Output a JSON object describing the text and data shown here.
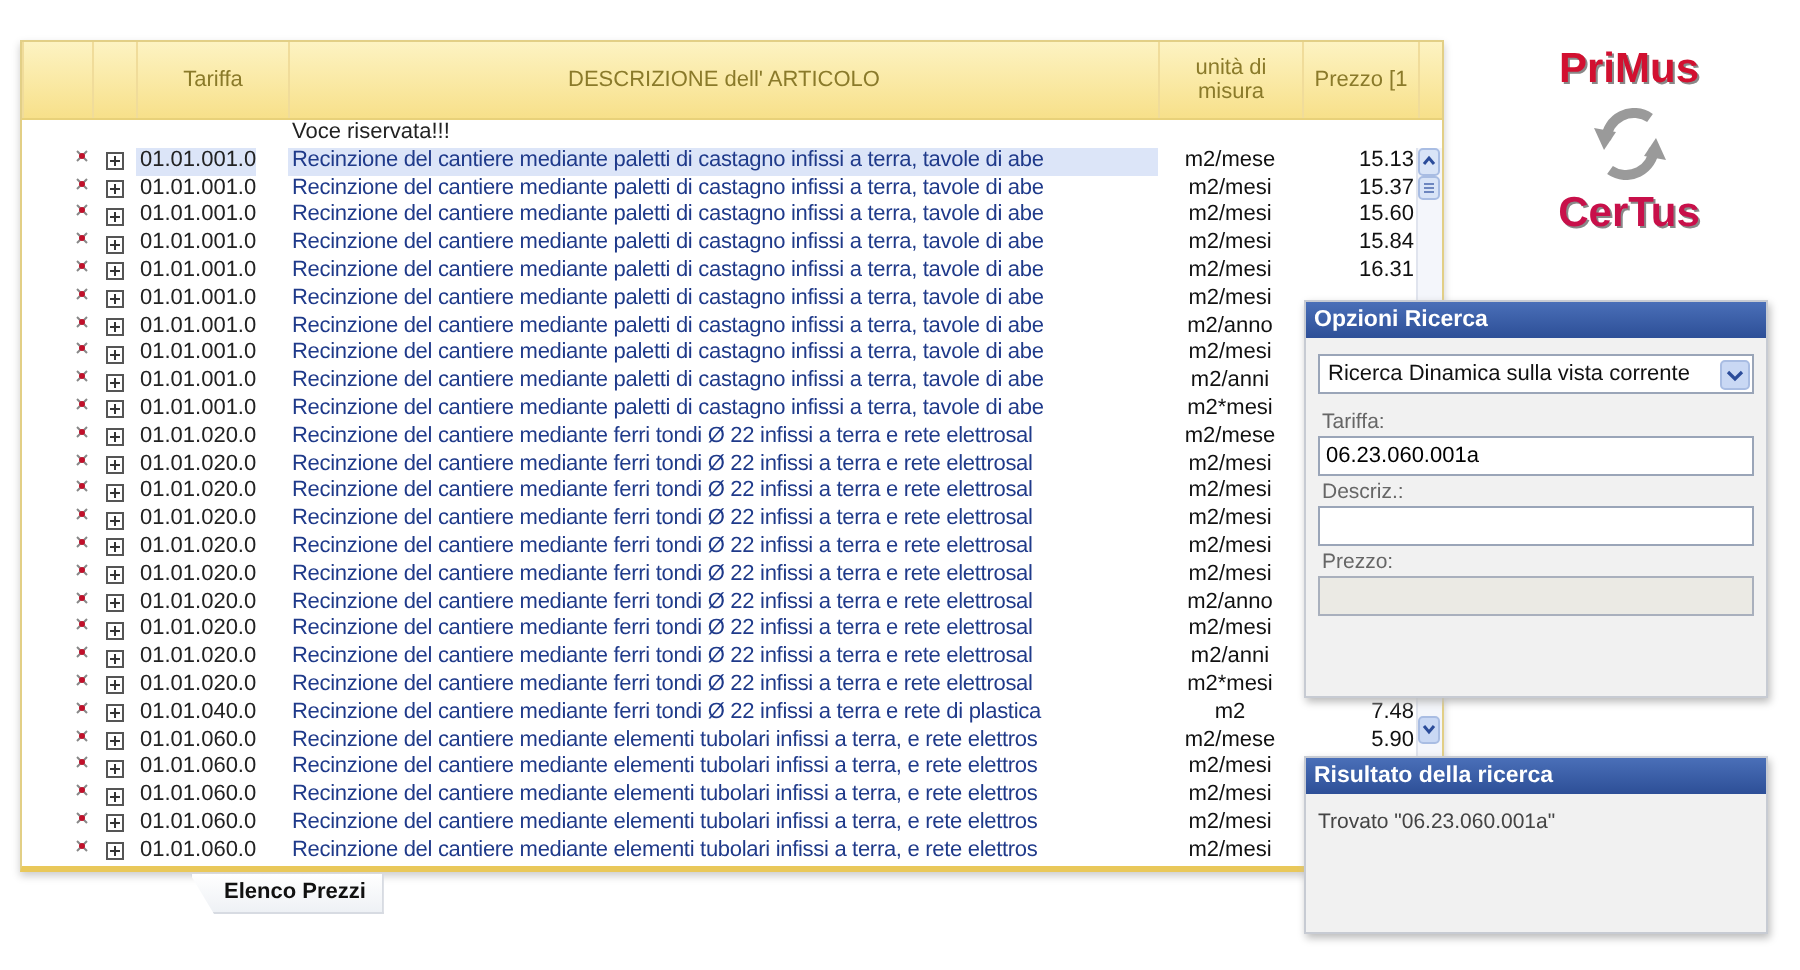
{
  "grid": {
    "columns": [
      "Tariffa",
      "DESCRIZIONE dell' ARTICOLO",
      "unità di misura",
      "Prezzo [1"
    ],
    "reserved_row": "Voce riservata!!!",
    "rows": [
      {
        "tariff": "01.01.001.0",
        "description": "Recinzione del cantiere mediante paletti di castagno infissi a terra, tavole di abe",
        "unit": "m2/mese",
        "price": "15.13",
        "selected": true
      },
      {
        "tariff": "01.01.001.0",
        "description": "Recinzione del cantiere mediante paletti di castagno infissi a terra, tavole di abe",
        "unit": "m2/mesi",
        "price": "15.37",
        "selected": false
      },
      {
        "tariff": "01.01.001.0",
        "description": "Recinzione del cantiere mediante paletti di castagno infissi a terra, tavole di abe",
        "unit": "m2/mesi",
        "price": "15.60",
        "selected": false
      },
      {
        "tariff": "01.01.001.0",
        "description": "Recinzione del cantiere mediante paletti di castagno infissi a terra, tavole di abe",
        "unit": "m2/mesi",
        "price": "15.84",
        "selected": false
      },
      {
        "tariff": "01.01.001.0",
        "description": "Recinzione del cantiere mediante paletti di castagno infissi a terra, tavole di abe",
        "unit": "m2/mesi",
        "price": "16.31",
        "selected": false
      },
      {
        "tariff": "01.01.001.0",
        "description": "Recinzione del cantiere mediante paletti di castagno infissi a terra, tavole di abe",
        "unit": "m2/mesi",
        "selected": false
      },
      {
        "tariff": "01.01.001.0",
        "description": "Recinzione del cantiere mediante paletti di castagno infissi a terra, tavole di abe",
        "unit": "m2/anno",
        "selected": false
      },
      {
        "tariff": "01.01.001.0",
        "description": "Recinzione del cantiere mediante paletti di castagno infissi a terra, tavole di abe",
        "unit": "m2/mesi",
        "selected": false
      },
      {
        "tariff": "01.01.001.0",
        "description": "Recinzione del cantiere mediante paletti di castagno infissi a terra, tavole di abe",
        "unit": "m2/anni",
        "selected": false
      },
      {
        "tariff": "01.01.001.0",
        "description": "Recinzione del cantiere mediante paletti di castagno infissi a terra, tavole di abe",
        "unit": "m2*mesi",
        "selected": false
      },
      {
        "tariff": "01.01.020.0",
        "description": "Recinzione del cantiere mediante ferri tondi Ø 22 infissi a terra e rete elettrosal",
        "unit": "m2/mese",
        "selected": false
      },
      {
        "tariff": "01.01.020.0",
        "description": "Recinzione del cantiere mediante ferri tondi Ø 22 infissi a terra e rete elettrosal",
        "unit": "m2/mesi",
        "selected": false
      },
      {
        "tariff": "01.01.020.0",
        "description": "Recinzione del cantiere mediante ferri tondi Ø 22 infissi a terra e rete elettrosal",
        "unit": "m2/mesi",
        "selected": false
      },
      {
        "tariff": "01.01.020.0",
        "description": "Recinzione del cantiere mediante ferri tondi Ø 22 infissi a terra e rete elettrosal",
        "unit": "m2/mesi",
        "selected": false
      },
      {
        "tariff": "01.01.020.0",
        "description": "Recinzione del cantiere mediante ferri tondi Ø 22 infissi a terra e rete elettrosal",
        "unit": "m2/mesi",
        "selected": false
      },
      {
        "tariff": "01.01.020.0",
        "description": "Recinzione del cantiere mediante ferri tondi Ø 22 infissi a terra e rete elettrosal",
        "unit": "m2/mesi",
        "selected": false
      },
      {
        "tariff": "01.01.020.0",
        "description": "Recinzione del cantiere mediante ferri tondi Ø 22 infissi a terra e rete elettrosal",
        "unit": "m2/anno",
        "selected": false
      },
      {
        "tariff": "01.01.020.0",
        "description": "Recinzione del cantiere mediante ferri tondi Ø 22 infissi a terra e rete elettrosal",
        "unit": "m2/mesi",
        "selected": false
      },
      {
        "tariff": "01.01.020.0",
        "description": "Recinzione del cantiere mediante ferri tondi Ø 22 infissi a terra e rete elettrosal",
        "unit": "m2/anni",
        "selected": false
      },
      {
        "tariff": "01.01.020.0",
        "description": "Recinzione del cantiere mediante ferri tondi Ø 22 infissi a terra e rete elettrosal",
        "unit": "m2*mesi",
        "selected": false
      },
      {
        "tariff": "01.01.040.0",
        "description": "Recinzione del cantiere mediante ferri tondi Ø 22 infissi a terra e rete di plastica",
        "unit": "m2",
        "price": "7.48",
        "selected": false
      },
      {
        "tariff": "01.01.060.0",
        "description": "Recinzione del cantiere mediante elementi tubolari infissi a terra, e rete elettros",
        "unit": "m2/mese",
        "price": "5.90",
        "selected": false
      },
      {
        "tariff": "01.01.060.0",
        "description": "Recinzione del cantiere mediante elementi tubolari infissi a terra, e rete elettros",
        "unit": "m2/mesi",
        "selected": false
      },
      {
        "tariff": "01.01.060.0",
        "description": "Recinzione del cantiere mediante elementi tubolari infissi a terra, e rete elettros",
        "unit": "m2/mesi",
        "selected": false
      },
      {
        "tariff": "01.01.060.0",
        "description": "Recinzione del cantiere mediante elementi tubolari infissi a terra, e rete elettros",
        "unit": "m2/mesi",
        "selected": false
      },
      {
        "tariff": "01.01.060.0",
        "description": "Recinzione del cantiere mediante elementi tubolari infissi a terra, e rete elettros",
        "unit": "m2/mesi",
        "selected": false
      }
    ]
  },
  "tab": {
    "label": "Elenco Prezzi"
  },
  "logo": {
    "top": "PriMus",
    "bottom": "CerTus"
  },
  "search_options": {
    "title": "Opzioni Ricerca",
    "mode": "Ricerca Dinamica sulla vista corrente",
    "fields": [
      {
        "label": "Tariffa:",
        "value": "06.23.060.001a",
        "disabled": false
      },
      {
        "label": "Descriz.:",
        "disabled": false
      },
      {
        "label": "Prezzo:",
        "disabled": true
      }
    ]
  },
  "search_result": {
    "title": "Risultato della ricerca",
    "message": "Trovato \"06.23.060.001a\""
  }
}
